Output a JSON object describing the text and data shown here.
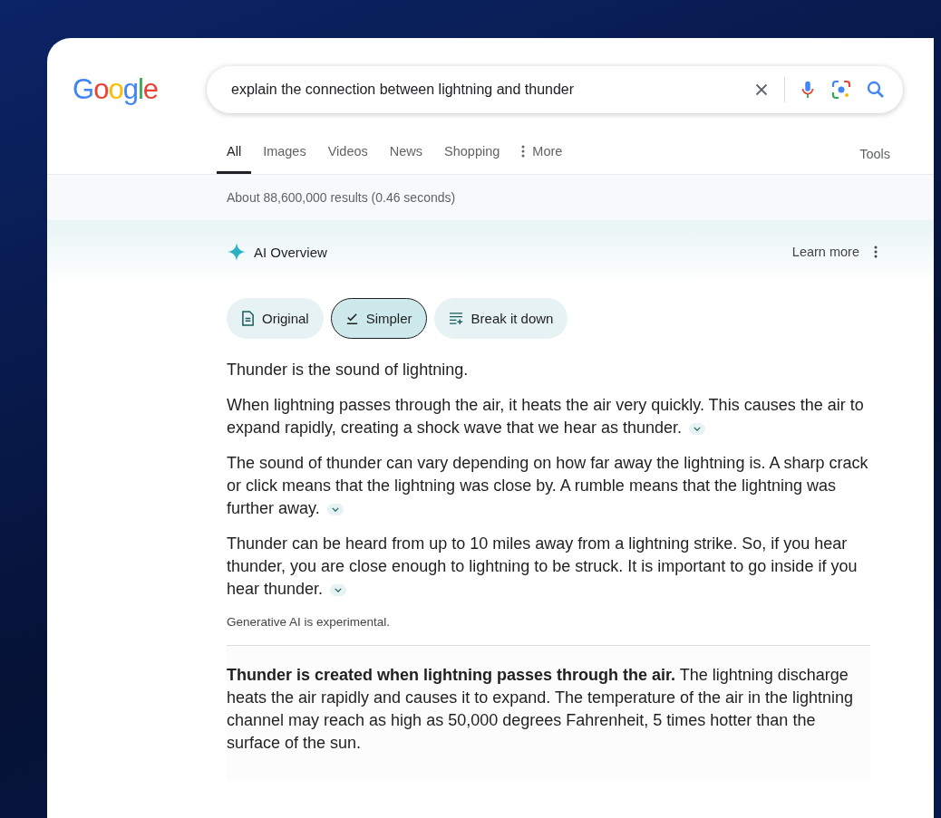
{
  "logo": "Google",
  "search": {
    "value": "explain the connection between lightning and thunder"
  },
  "tabs": [
    {
      "label": "All",
      "selected": true,
      "kind": "tab"
    },
    {
      "label": "Images",
      "selected": false,
      "kind": "tab"
    },
    {
      "label": "Videos",
      "selected": false,
      "kind": "tab"
    },
    {
      "label": "News",
      "selected": false,
      "kind": "tab"
    },
    {
      "label": "Shopping",
      "selected": false,
      "kind": "tab"
    },
    {
      "label": "More",
      "selected": false,
      "kind": "menu"
    }
  ],
  "tools": "Tools",
  "result_stats": "About 88,600,000 results (0.46 seconds)",
  "ai_overview": {
    "title": "AI Overview",
    "learn_more": "Learn more",
    "chips": [
      {
        "label": "Original",
        "kind": "document",
        "selected": false
      },
      {
        "label": "Simpler",
        "kind": "check",
        "selected": true
      },
      {
        "label": "Break it down",
        "kind": "list",
        "selected": false
      }
    ],
    "paragraphs": [
      {
        "text": "Thunder is the sound of lightning.",
        "expandable": false
      },
      {
        "text": "When lightning passes through the air, it heats the air very quickly. This causes the air to expand rapidly, creating a shock wave that we hear as thunder.",
        "expandable": true
      },
      {
        "text": "The sound of thunder can vary depending on how far away the lightning is. A sharp crack or click means that the lightning was close by. A rumble means that the lightning was further away.",
        "expandable": true
      },
      {
        "text": "Thunder can be heard from up to 10 miles away from a lightning strike. So, if you hear thunder, you are close enough to lightning to be struck. It is important to go inside if you hear thunder.",
        "expandable": true
      }
    ],
    "disclaimer": "Generative AI is experimental.",
    "source_text": "**Thunder is created when lightning passes through the air.** The lightning discharge heats the air rapidly and causes it to expand. The temperature of the air in the lightning channel may reach as high as 50,000 degrees Fahrenheit, 5 times hotter than the surface of the sun."
  }
}
